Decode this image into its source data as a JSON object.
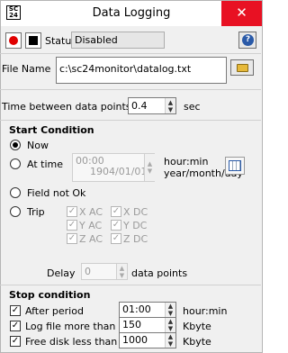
{
  "window": {
    "title": "Data Logging",
    "close_glyph": "✕",
    "app_icon_text": "SC 24"
  },
  "toolbar": {
    "status_label": "Status",
    "status_value": "Disabled",
    "help_glyph": "?"
  },
  "file": {
    "label": "File Name",
    "value": "c:\\sc24monitor\\datalog.txt"
  },
  "interval": {
    "label": "Time between data points",
    "value": "0.4",
    "unit": "sec"
  },
  "start": {
    "title": "Start Condition",
    "now_label": "Now",
    "at_time_label": "At time",
    "time_value": "00:00",
    "date_value": "1904/01/01",
    "time_unit": "hour:min",
    "date_unit": "year/month/day",
    "field_not_ok_label": "Field not Ok",
    "trip_label": "Trip",
    "trip_channels": [
      "X AC",
      "X DC",
      "Y AC",
      "Y DC",
      "Z AC",
      "Z DC"
    ],
    "delay_label": "Delay",
    "delay_value": "0",
    "delay_unit": "data points",
    "selected": "Now"
  },
  "stop": {
    "title": "Stop condition",
    "after_period_label": "After period",
    "after_period_value": "01:00",
    "after_period_unit": "hour:min",
    "log_file_label": "Log file more than",
    "log_file_value": "150",
    "log_file_unit": "Kbyte",
    "free_disk_label": "Free disk less than",
    "free_disk_value": "1000",
    "free_disk_unit": "Kbyte"
  },
  "icons": {
    "record": "record-icon",
    "stop": "stop-icon",
    "help": "help-icon",
    "folder": "folder-icon",
    "calendar": "calendar-icon",
    "spin": "spinner-arrows-icon"
  },
  "colors": {
    "close": "#e81123",
    "record": "#e00000",
    "help": "#2a5aa8"
  }
}
